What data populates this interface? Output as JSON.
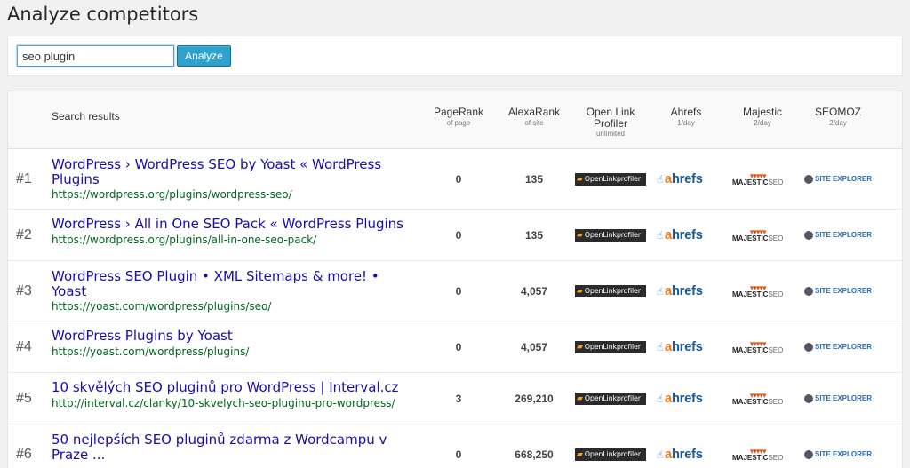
{
  "page": {
    "title": "Analyze competitors"
  },
  "search": {
    "value": "seo plugin",
    "button_label": "Analyze"
  },
  "table": {
    "headers": {
      "search_results": "Search results",
      "pagerank": {
        "main": "PageRank",
        "sub": "of page"
      },
      "alexarank": {
        "main": "AlexaRank",
        "sub": "of site"
      },
      "openlink": {
        "main1": "Open Link",
        "main2": "Profiler",
        "sub": "unlimited"
      },
      "ahrefs": {
        "main": "Ahrefs",
        "sub": "1/day"
      },
      "majestic": {
        "main": "Majestic",
        "sub": "2/day"
      },
      "seomoz": {
        "main": "SEOMOZ",
        "sub": "2/day"
      }
    },
    "badges": {
      "openlink": "OpenLinkprofiler",
      "ahrefs_a": "a",
      "ahrefs_rest": "hrefs",
      "majestic_main": "MAJESTIC",
      "majestic_seo": "SEO",
      "seomoz_small": "SEOMOZ",
      "seomoz_main": "SITE EXPLORER"
    },
    "rows": [
      {
        "rank": "#1",
        "title_line1": "WordPress › WordPress SEO by Yoast « WordPress",
        "title_line2": "Plugins",
        "url": "https://wordpress.org/plugins/wordpress-seo/",
        "pagerank": "0",
        "alexarank": "135"
      },
      {
        "rank": "#2",
        "title_line1": "WordPress › All in One SEO Pack « WordPress Plugins",
        "title_line2": "",
        "url": "https://wordpress.org/plugins/all-in-one-seo-pack/",
        "pagerank": "0",
        "alexarank": "135"
      },
      {
        "rank": "#3",
        "title_line1": "WordPress SEO Plugin • XML Sitemaps & more! •",
        "title_line2": "Yoast",
        "url": "https://yoast.com/wordpress/plugins/seo/",
        "pagerank": "0",
        "alexarank": "4,057"
      },
      {
        "rank": "#4",
        "title_line1": "WordPress Plugins by Yoast",
        "title_line2": "",
        "url": "https://yoast.com/wordpress/plugins/",
        "pagerank": "0",
        "alexarank": "4,057"
      },
      {
        "rank": "#5",
        "title_line1": "10 skvělých SEO pluginů pro WordPress | Interval.cz",
        "title_line2": "",
        "url": "http://interval.cz/clanky/10-skvelych-seo-pluginu-pro-wordpress/",
        "pagerank": "3",
        "alexarank": "269,210"
      },
      {
        "rank": "#6",
        "title_line1": "50 nejlepších SEO pluginů zdarma z Wordcampu v",
        "title_line2": "Praze ...",
        "url": "",
        "pagerank": "0",
        "alexarank": "668,250"
      }
    ]
  },
  "colors": {
    "link": "#1a0dab",
    "url": "#006621",
    "button": "#2ea2cc",
    "ahrefs_orange": "#f47d20",
    "majestic_orange": "#e2561b"
  }
}
